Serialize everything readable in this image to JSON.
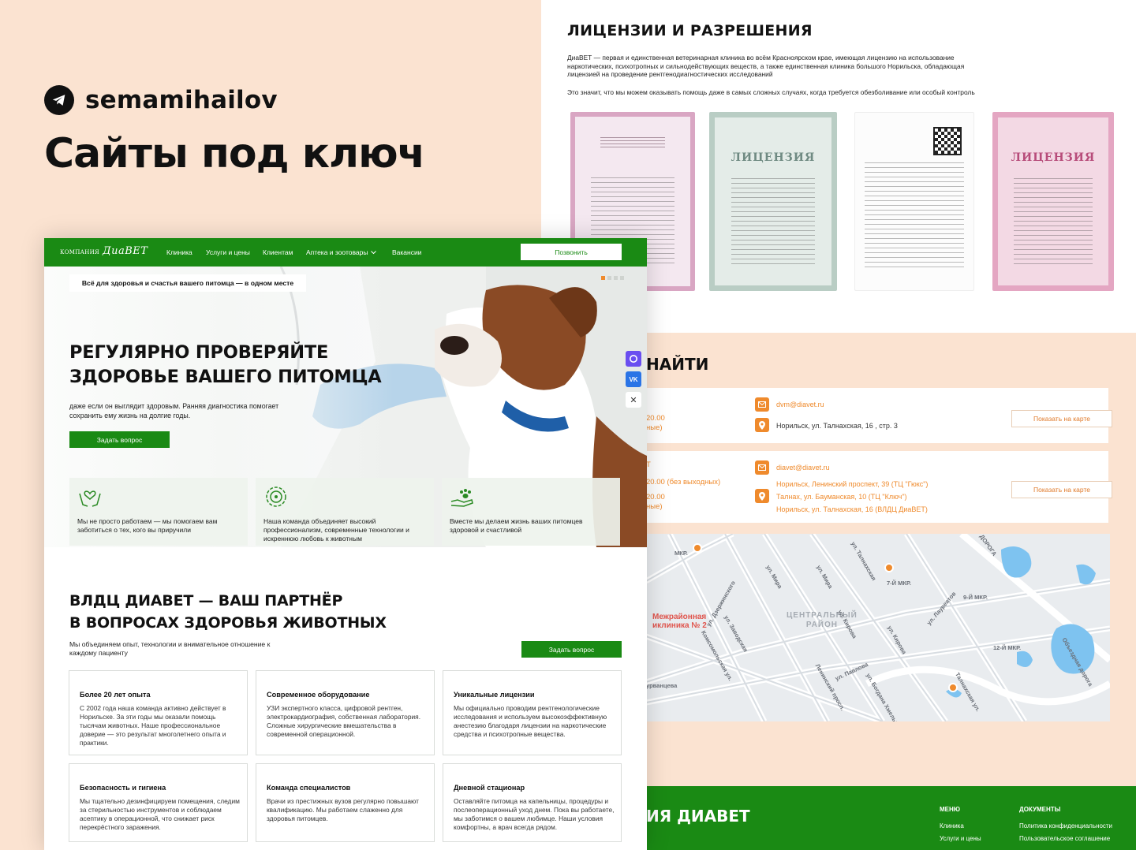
{
  "promo": {
    "handle": "semamihailov",
    "title": "Сайты под ключ",
    "telegram_icon": "telegram-icon"
  },
  "licenses": {
    "title": "ЛИЦЕНЗИИ И РАЗРЕШЕНИЯ",
    "text": "ДиаВЕТ — первая и единственная ветеринарная клиника во всём Красноярском крае, имеющая лицензию на использование наркотических, психотропных и сильнодействующих веществ, а также единственная клиника большого Норильска, обладающая лицензией на проведение рентгенодиагностических исследований",
    "text2": "Это значит, что мы можем оказывать помощь даже в самых сложных случаях, когда требуется обезболивание или особый контроль",
    "doc_word": "ЛИЦЕНЗИЯ"
  },
  "contacts": {
    "title_visible": "НАЙТИ",
    "card1": {
      "hours": "20.00",
      "hours_note": "ные)",
      "email": "dvm@diavet.ru",
      "address": "Норильск, ул. Талнахская, 16 , стр. 3",
      "map_button": "Показать на карте"
    },
    "card2": {
      "letter": "Т",
      "hours1": "20.00 (без выходных)",
      "hours2": "20.00",
      "hours_note": "ные)",
      "email": "diavet@diavet.ru",
      "address1": "Норильск, Ленинский проспект, 39 (ТЦ \"Гюкс\")",
      "address2": "Талнах, ул. Бауманская, 10 (ТЦ \"Ключ\")",
      "address3": "Норильск, ул. Талнахская, 16 (ВЛДЦ ДиаВЕТ)",
      "map_button": "Показать на карте"
    },
    "map": {
      "district_1": "ЦЕНТРАЛЬНЫЙ",
      "district_2": "РАЙОН",
      "hospital_1": "Межрайонная",
      "hospital_2": "иклиника № 2",
      "labels": [
        "7-Й МКР.",
        "9-Й МКР.",
        "12-Й МКР.",
        "МКР.",
        "ул. Талнахская",
        "ул. Кирова",
        "ул. Павлова",
        "ул. Богдана Хмельн.",
        "Комсомольская ул.",
        "ул. Дзержинского",
        "ул. Мира",
        "ул. Заводская",
        "ул. Лауреатов",
        "Объездная дорога",
        "Талнахская ул.",
        "Ленинский просп.",
        "урванцева",
        "ДОРОГА",
        "ул. Мира",
        "ул. Кирова"
      ]
    }
  },
  "footer": {
    "brand": "ИЯ ДИАВЕТ",
    "menu_title": "МЕНЮ",
    "menu_items": [
      "Клиника",
      "Услуги и цены"
    ],
    "docs_title": "ДОКУМЕНТЫ",
    "docs_items": [
      "Политика конфиденциальности",
      "Пользовательское соглашение"
    ]
  },
  "site": {
    "logo_small": "КОМПАНИЯ",
    "logo_big": "ДиаВЕТ",
    "nav": [
      "Клиника",
      "Услуги и цены",
      "Клиентам",
      "Аптека и зоотовары",
      "Вакансии"
    ],
    "call_button": "Позвонить",
    "hero": {
      "tag": "Всё для здоровья и счастья вашего питомца — в одном месте",
      "title_line1": "РЕГУЛЯРНО ПРОВЕРЯЙТЕ",
      "title_line2": "ЗДОРОВЬЕ ВАШЕГО ПИТОМЦА",
      "subtitle": "даже если он выглядит здоровым. Ранняя диагностика помогает сохранить ему жизнь на долгие годы.",
      "button": "Задать вопрос",
      "features": [
        "Мы не просто работаем — мы помогаем вам заботиться о тех, кого вы приручили",
        "Наша команда объединяет высокий профессионализм, современные технологии и искреннюю любовь к животным",
        "Вместе мы делаем жизнь ваших питомцев здоровой и счастливой"
      ]
    },
    "about": {
      "title_line1": "ВЛДЦ ДИАВЕТ — ВАШ ПАРТНЁР",
      "title_line2": "В ВОПРОСАХ ЗДОРОВЬЯ ЖИВОТНЫХ",
      "text": "Мы объединяем опыт, технологии и внимательное отношение к каждому пациенту",
      "button": "Задать вопрос",
      "cards": [
        {
          "title": "Более 20 лет опыта",
          "text": "С 2002 года наша команда активно действует в Норильске. За эти годы мы оказали помощь тысячам животных. Наше профессиональное доверие — это результат многолетнего опыта и практики."
        },
        {
          "title": "Современное оборудование",
          "text": "УЗИ экспертного класса, цифровой рентген, электрокардиография, собственная лаборатория. Сложные хирургические вмешательства  в современной операционной."
        },
        {
          "title": "Уникальные лицензии",
          "text": "Мы официально проводим рентгенологические исследования и используем высокоэффективную анестезию благодаря лицензии на наркотические средства и психотропные вещества."
        },
        {
          "title": "Безопасность и гигиена",
          "text": "Мы тщательно дезинфицируем помещения, следим за стерильностью инструментов и соблюдаем асептику в операционной, что снижает риск перекрёстного заражения."
        },
        {
          "title": "Команда специалистов",
          "text": "Врачи из престижных вузов регулярно повышают квалификацию. Мы работаем слаженно для здоровья питомцев."
        },
        {
          "title": "Дневной стационар",
          "text": "Оставляйте питомца на капельницы, процедуры и послеоперационный уход днем. Пока вы работаете, мы заботимся о вашем любимце. Наши условия комфортны, а врач всегда рядом."
        }
      ]
    }
  }
}
